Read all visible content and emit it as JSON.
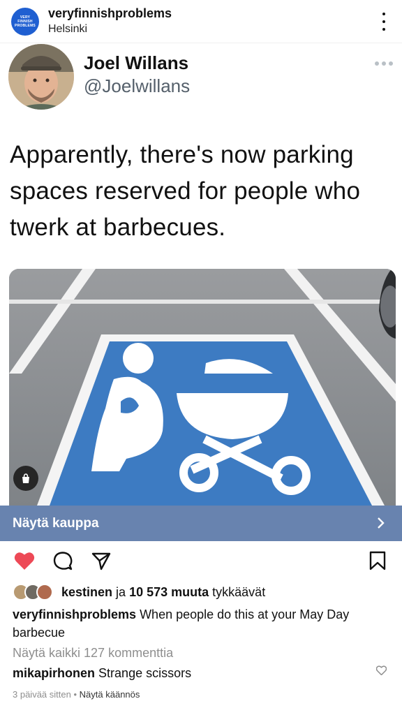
{
  "header": {
    "username": "veryfinnishproblems",
    "location": "Helsinki",
    "avatar_lines": [
      "VERY",
      "FINNISH",
      "PROBLEMS"
    ],
    "more_icon": "more-vertical-icon"
  },
  "tweet": {
    "name": "Joel Willans",
    "handle": "@Joelwillans",
    "text": "Apparently, there's now parking spaces reserved for people who twerk at barbecues."
  },
  "shop": {
    "label": "Näytä kauppa",
    "icon": "shopping-bag-icon"
  },
  "actions": {
    "liked": true,
    "like_color": "#ed4956",
    "icons": [
      "heart-icon",
      "comment-icon",
      "share-icon",
      "bookmark-icon"
    ]
  },
  "likes": {
    "first_user": "kestinen",
    "connector": "ja",
    "count_text": "10 573 muuta",
    "suffix": "tykkäävät"
  },
  "caption": {
    "username": "veryfinnishproblems",
    "text": "When people do this at your May Day barbecue"
  },
  "comments": {
    "view_all": "Näytä kaikki 127 kommenttia",
    "items": [
      {
        "username": "mikapirhonen",
        "text": "Strange scissors"
      }
    ]
  },
  "meta": {
    "time": "3 päivää sitten",
    "separator": "•",
    "translate": "Näytä käännös"
  },
  "colors": {
    "shop_bar": "#6883af",
    "parking_blue": "#3d7bc2"
  }
}
